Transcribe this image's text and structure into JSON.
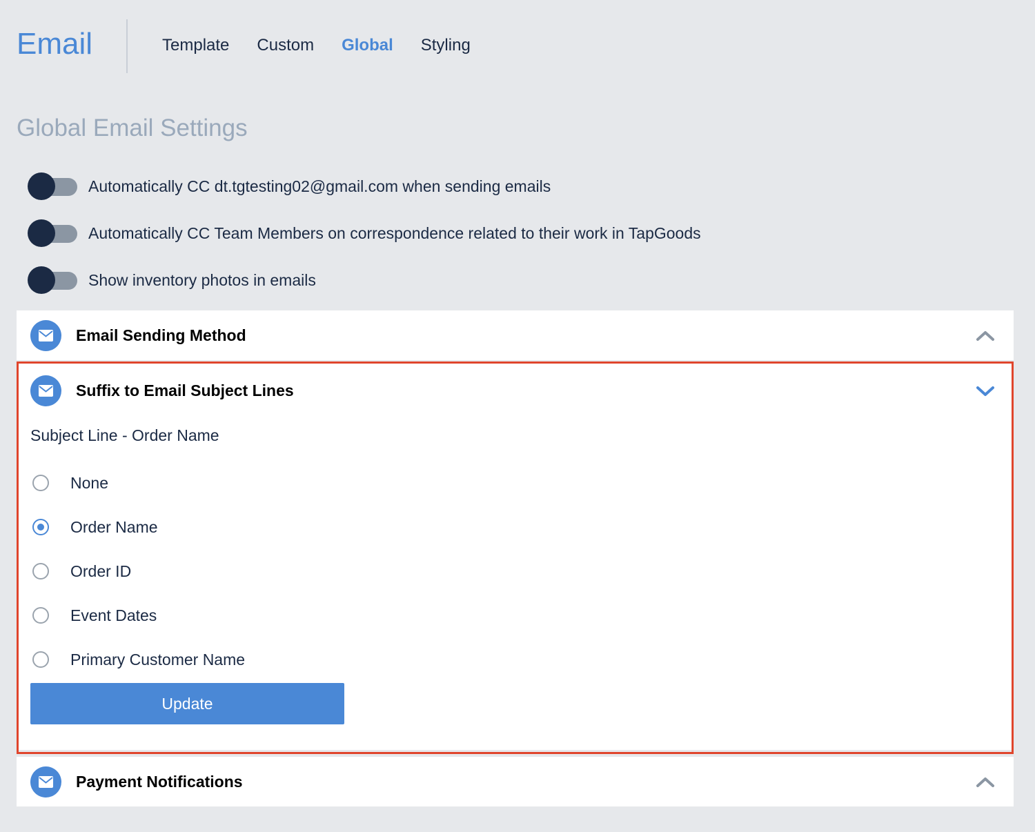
{
  "header": {
    "title": "Email",
    "tabs": [
      {
        "label": "Template",
        "active": false
      },
      {
        "label": "Custom",
        "active": false
      },
      {
        "label": "Global",
        "active": true
      },
      {
        "label": "Styling",
        "active": false
      }
    ]
  },
  "section_title": "Global Email Settings",
  "toggles": [
    {
      "label": "Automatically CC dt.tgtesting02@gmail.com when sending emails",
      "on": false
    },
    {
      "label": "Automatically CC Team Members on correspondence related to their work in TapGoods",
      "on": false
    },
    {
      "label": "Show inventory photos in emails",
      "on": false
    }
  ],
  "panels": {
    "sending_method": {
      "title": "Email Sending Method",
      "icon": "mail-icon",
      "expanded": false
    },
    "suffix": {
      "title": "Suffix to Email Subject Lines",
      "icon": "mail-icon",
      "expanded": true
    },
    "payment": {
      "title": "Payment Notifications",
      "icon": "mail-icon",
      "expanded": false
    }
  },
  "suffix_form": {
    "label": "Subject Line - Order Name",
    "options": [
      {
        "label": "None",
        "checked": false
      },
      {
        "label": "Order Name",
        "checked": true
      },
      {
        "label": "Order ID",
        "checked": false
      },
      {
        "label": "Event Dates",
        "checked": false
      },
      {
        "label": "Primary Customer Name",
        "checked": false
      }
    ],
    "button_label": "Update"
  },
  "colors": {
    "accent": "#4a88d6",
    "background": "#e6e8eb",
    "text": "#1b2a44",
    "highlight_border": "#e0452c"
  }
}
